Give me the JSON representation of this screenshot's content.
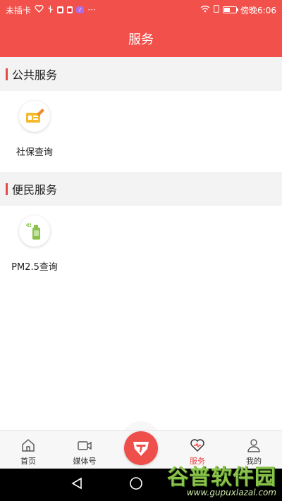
{
  "status_bar": {
    "carrier": "未插卡",
    "time": "傍晚6:06",
    "battery_level": 0.5,
    "icons": [
      "heart-rate-icon",
      "usb-icon",
      "app-badge-icon",
      "store-badge-icon",
      "music-icon",
      "more-dots-icon",
      "wifi-icon",
      "sim-icon",
      "battery-icon"
    ]
  },
  "header": {
    "title": "服务"
  },
  "sections": [
    {
      "title": "公共服务",
      "items": [
        {
          "label": "社保查询",
          "icon": "social-security-card-icon"
        }
      ]
    },
    {
      "title": "便民服务",
      "items": [
        {
          "label": "PM2.5查询",
          "icon": "air-quality-spray-icon"
        }
      ]
    }
  ],
  "bottom_nav": {
    "items": [
      {
        "label": "首页",
        "icon": "home-icon"
      },
      {
        "label": "媒体号",
        "icon": "video-camera-icon"
      },
      {
        "label": "",
        "icon": "center-logo-icon"
      },
      {
        "label": "服务",
        "icon": "heart-service-icon"
      },
      {
        "label": "我的",
        "icon": "user-icon"
      }
    ],
    "active": "服务"
  },
  "system_nav": {
    "icons": [
      "back-triangle-icon",
      "home-circle-icon"
    ]
  },
  "watermark": {
    "title": "谷普软件园",
    "url": "www.gupuxlazal.com"
  },
  "colors": {
    "accent": "#f2504b",
    "section_bar": "#e84a4a"
  }
}
